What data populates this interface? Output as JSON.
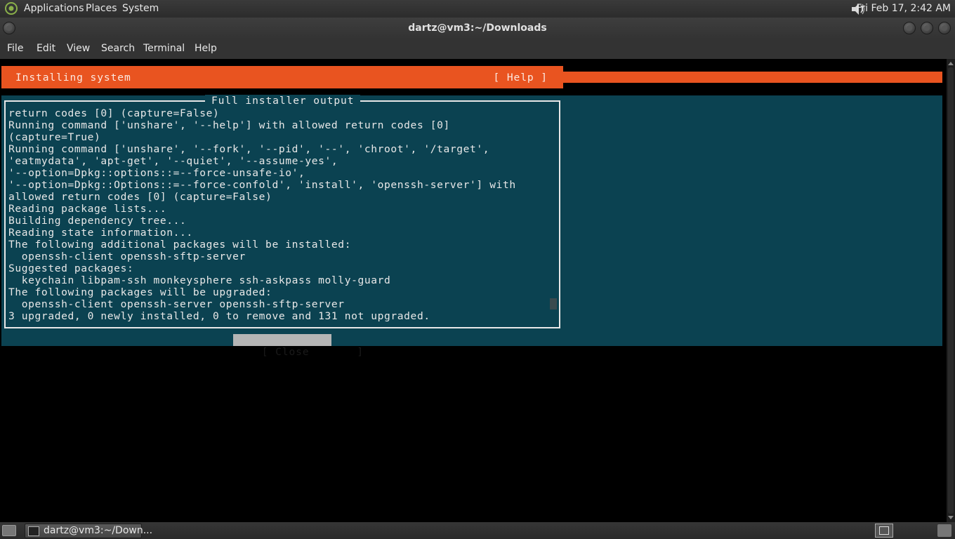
{
  "top_panel": {
    "menus": [
      "Applications",
      "Places",
      "System"
    ],
    "clock": "Fri Feb 17,  2:42 AM",
    "icons": [
      "applications-logo-icon",
      "volume-icon"
    ]
  },
  "window": {
    "title": "dartz@vm3:~/Downloads"
  },
  "menubar": {
    "items": [
      "File",
      "Edit",
      "View",
      "Search",
      "Terminal",
      "Help"
    ]
  },
  "installer": {
    "header_title": "Installing system",
    "help_label": "[ Help ]",
    "dialog_title": "Full installer output",
    "output_lines": [
      "return codes [0] (capture=False)",
      "Running command ['unshare', '--help'] with allowed return codes [0]",
      "(capture=True)",
      "Running command ['unshare', '--fork', '--pid', '--', 'chroot', '/target',",
      "'eatmydata', 'apt-get', '--quiet', '--assume-yes',",
      "'--option=Dpkg::options::=--force-unsafe-io',",
      "'--option=Dpkg::Options::=--force-confold', 'install', 'openssh-server'] with",
      "allowed return codes [0] (capture=False)",
      "Reading package lists...",
      "Building dependency tree...",
      "Reading state information...",
      "The following additional packages will be installed:",
      "  openssh-client openssh-sftp-server",
      "Suggested packages:",
      "  keychain libpam-ssh monkeysphere ssh-askpass molly-guard",
      "The following packages will be upgraded:",
      "  openssh-client openssh-server openssh-sftp-server",
      "3 upgraded, 0 newly installed, 0 to remove and 131 not upgraded."
    ],
    "close_label": "[ Close       ]"
  },
  "taskbar": {
    "task_label": "dartz@vm3:~/Down..."
  },
  "colors": {
    "ubuntu_orange": "#e95420",
    "installer_teal": "#0b4251"
  }
}
